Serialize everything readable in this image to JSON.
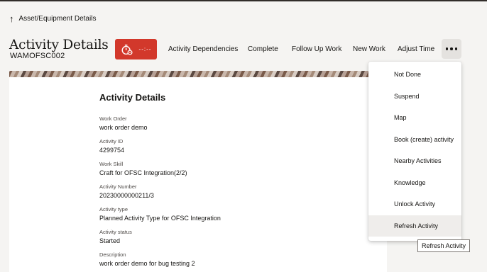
{
  "breadcrumb": {
    "label": "Asset/Equipment Details"
  },
  "header": {
    "title": "Activity Details",
    "subtitle": "WAMOFSC002",
    "timer_value": "--:--"
  },
  "toolbar": {
    "actions": [
      "Activity Dependencies",
      "Complete",
      "Follow Up Work",
      "New Work",
      "Adjust Time"
    ]
  },
  "details": {
    "section_title": "Activity Details",
    "fields": [
      {
        "label": "Work Order",
        "value": "work order demo"
      },
      {
        "label": "Activity ID",
        "value": "4299754"
      },
      {
        "label": "Work Skill",
        "value": "Craft for OFSC Integration(2/2)"
      },
      {
        "label": "Activity Number",
        "value": "20230000000211/3"
      },
      {
        "label": "Activity type",
        "value": "Planned Activity Type for OFSC Integration"
      },
      {
        "label": "Activity status",
        "value": "Started"
      },
      {
        "label": "Description",
        "value": "work order demo for bug testing 2"
      }
    ]
  },
  "overflow_menu": {
    "items": [
      "Not Done",
      "Suspend",
      "Map",
      "Book (create) activity",
      "Nearby Activities",
      "Knowledge",
      "Unlock Activity",
      "Refresh Activity"
    ],
    "highlighted_index": 7
  },
  "tooltip": {
    "text": "Refresh Activity"
  },
  "colors": {
    "accent_red": "#d2382b",
    "page_background": "#f5f4f2",
    "text": "#161513"
  },
  "icons": {
    "breadcrumb": "arrow-up-icon",
    "timer": "stopwatch-gear-icon",
    "overflow": "more-horizontal-icon"
  }
}
